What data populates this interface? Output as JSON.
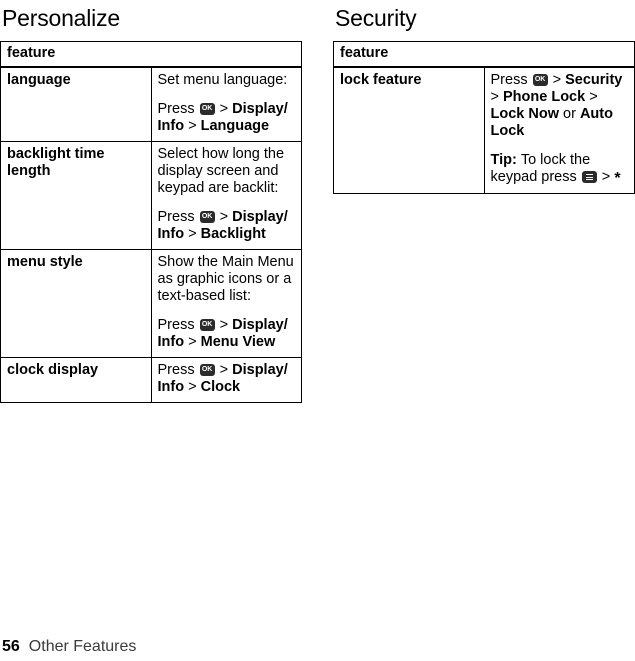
{
  "sections": [
    {
      "title": "Personalize",
      "header": "feature",
      "rows": [
        {
          "key": "language",
          "lines": [
            {
              "parts": [
                {
                  "t": "text",
                  "v": "Set menu language:"
                }
              ]
            },
            {
              "parts": [
                {
                  "t": "text",
                  "v": "Press "
                },
                {
                  "t": "icon",
                  "v": "ok-key-icon"
                },
                {
                  "t": "sep",
                  "v": " > "
                },
                {
                  "t": "bold",
                  "v": "Display/ Info"
                },
                {
                  "t": "sep",
                  "v": " > "
                },
                {
                  "t": "bold",
                  "v": "Language"
                }
              ]
            }
          ]
        },
        {
          "key": "backlight time length",
          "lines": [
            {
              "parts": [
                {
                  "t": "text",
                  "v": "Select how long the display screen and keypad are backlit:"
                }
              ]
            },
            {
              "parts": [
                {
                  "t": "text",
                  "v": "Press "
                },
                {
                  "t": "icon",
                  "v": "ok-key-icon"
                },
                {
                  "t": "sep",
                  "v": " > "
                },
                {
                  "t": "bold",
                  "v": "Display/ Info"
                },
                {
                  "t": "sep",
                  "v": " > "
                },
                {
                  "t": "bold",
                  "v": "Backlight"
                }
              ]
            }
          ]
        },
        {
          "key": "menu style",
          "lines": [
            {
              "parts": [
                {
                  "t": "text",
                  "v": "Show the Main Menu as graphic icons or a text-based list:"
                }
              ]
            },
            {
              "parts": [
                {
                  "t": "text",
                  "v": "Press "
                },
                {
                  "t": "icon",
                  "v": "ok-key-icon"
                },
                {
                  "t": "sep",
                  "v": " > "
                },
                {
                  "t": "bold",
                  "v": "Display/ Info"
                },
                {
                  "t": "sep",
                  "v": " > "
                },
                {
                  "t": "bold",
                  "v": "Menu View"
                }
              ]
            }
          ]
        },
        {
          "key": "clock display",
          "lines": [
            {
              "parts": [
                {
                  "t": "text",
                  "v": "Press "
                },
                {
                  "t": "icon",
                  "v": "ok-key-icon"
                },
                {
                  "t": "sep",
                  "v": " > "
                },
                {
                  "t": "bold",
                  "v": "Display/ Info"
                },
                {
                  "t": "sep",
                  "v": " > "
                },
                {
                  "t": "bold",
                  "v": "Clock"
                }
              ]
            }
          ]
        }
      ]
    },
    {
      "title": "Security",
      "header": "feature",
      "rows": [
        {
          "key": "lock feature",
          "lines": [
            {
              "parts": [
                {
                  "t": "text",
                  "v": "Press "
                },
                {
                  "t": "icon",
                  "v": "ok-key-icon"
                },
                {
                  "t": "sep",
                  "v": " > "
                },
                {
                  "t": "bold",
                  "v": "Security"
                },
                {
                  "t": "sep",
                  "v": " > "
                },
                {
                  "t": "bold",
                  "v": "Phone Lock"
                },
                {
                  "t": "sep",
                  "v": " > "
                },
                {
                  "t": "bold",
                  "v": "Lock Now"
                },
                {
                  "t": "text",
                  "v": " or "
                },
                {
                  "t": "bold",
                  "v": "Auto Lock"
                }
              ]
            },
            {
              "tip": true,
              "parts": [
                {
                  "t": "tiplabel",
                  "v": "Tip: "
                },
                {
                  "t": "text",
                  "v": "To lock the keypad press "
                },
                {
                  "t": "icon",
                  "v": "menu-key-icon"
                },
                {
                  "t": "sep",
                  "v": " > "
                },
                {
                  "t": "star",
                  "v": "*"
                }
              ]
            }
          ]
        }
      ]
    }
  ],
  "footer": {
    "page_number": "56",
    "label": "Other Features"
  }
}
